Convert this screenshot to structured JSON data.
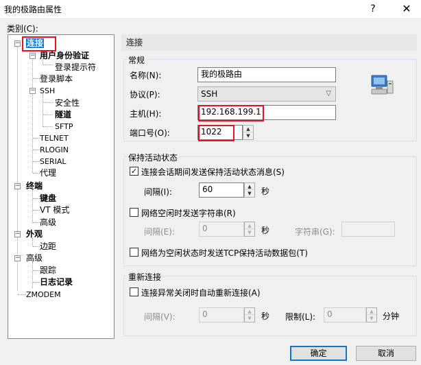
{
  "window": {
    "title": "我的极路由属性",
    "help_label": "?",
    "close_label": "✕"
  },
  "category_label": "类别(C):",
  "tree": {
    "connection": "连接",
    "user_auth": "用户身份验证",
    "login_prompt": "登录提示符",
    "login_script": "登录脚本",
    "ssh": "SSH",
    "security": "安全性",
    "tunnel": "隧道",
    "sftp": "SFTP",
    "telnet": "TELNET",
    "rlogin": "RLOGIN",
    "serial": "SERIAL",
    "proxy": "代理",
    "terminal": "终端",
    "keyboard": "键盘",
    "vt_mode": "VT 模式",
    "advanced": "高级",
    "appearance": "外观",
    "margin": "边距",
    "advanced2": "高级",
    "trace": "跟踪",
    "logging": "日志记录",
    "zmodem": "ZMODEM"
  },
  "panel": {
    "header": "连接",
    "general": {
      "title": "常规",
      "name_label": "名称(N):",
      "name_value": "我的极路由",
      "protocol_label": "协议(P):",
      "protocol_value": "SSH",
      "host_label": "主机(H):",
      "host_value": "192.168.199.1",
      "port_label": "端口号(O):",
      "port_value": "1022"
    },
    "keepalive": {
      "title": "保持活动状态",
      "send_keepalive_label": "连接会话期间发送保持活动状态消息(S)",
      "send_keepalive_checked": true,
      "interval_label": "间隔(I):",
      "interval_value": "60",
      "seconds": "秒",
      "idle_string_label": "网络空闲时发送字符串(R)",
      "idle_string_checked": false,
      "interval2_label": "间隔(E):",
      "interval2_value": "0",
      "seconds2": "秒",
      "string_label": "字符串(G):",
      "string_value": "",
      "tcp_keepalive_label": "网络为空闲状态时发送TCP保持活动数据包(T)",
      "tcp_keepalive_checked": false
    },
    "reconnect": {
      "title": "重新连接",
      "auto_reconnect_label": "连接异常关闭时自动重新连接(A)",
      "auto_reconnect_checked": false,
      "interval_label": "间隔(V):",
      "interval_value": "0",
      "seconds": "秒",
      "limit_label": "限制(L):",
      "limit_value": "0",
      "minutes": "分钟"
    }
  },
  "buttons": {
    "ok": "确定",
    "cancel": "取消"
  },
  "colors": {
    "selection": "#0078d7",
    "highlight_outline": "#e81123"
  }
}
